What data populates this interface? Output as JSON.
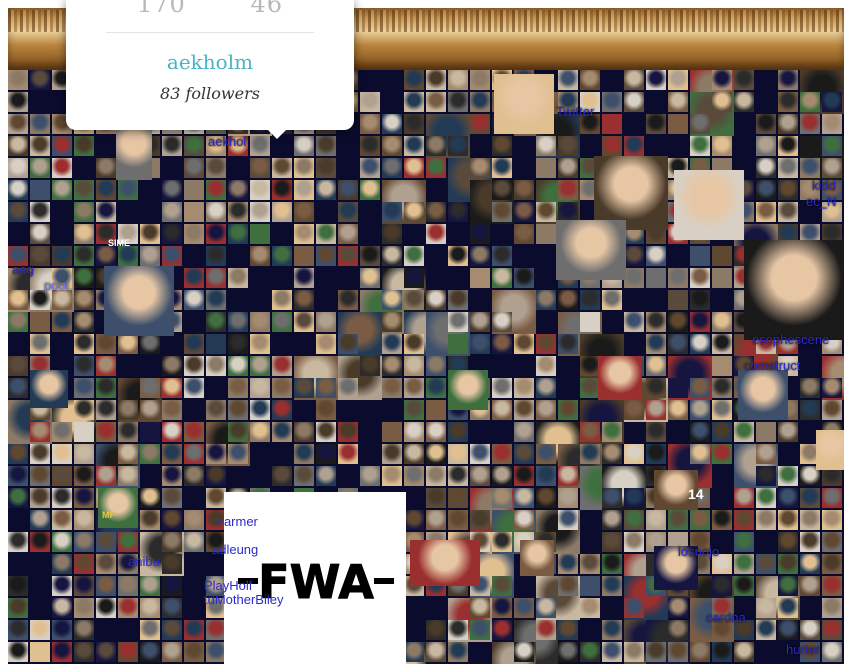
{
  "popup": {
    "stats": [
      "170",
      "46"
    ],
    "username": "aekholm",
    "followers": "83 followers"
  },
  "fwa_logo": "FWA",
  "handles": [
    {
      "text": "aekhol"
    },
    {
      "text": "Twitter"
    },
    {
      "text": "kidd"
    },
    {
      "text": "ec_N"
    },
    {
      "text": "aeg"
    },
    {
      "text": "pool"
    },
    {
      "text": "esophescene"
    },
    {
      "text": "comstruct"
    },
    {
      "text": "losnojo"
    },
    {
      "text": "cardna"
    },
    {
      "text": "hurter"
    },
    {
      "text": "Farmer"
    },
    {
      "text": "adleung"
    },
    {
      "text": "tdMotherBiley"
    },
    {
      "text": "PlayHolf"
    },
    {
      "text": "anibu"
    }
  ],
  "tile_labels": {
    "sime": "SIME",
    "mf": "MF",
    "fourteen": "14"
  },
  "colors": {
    "mosaic_bg": "#0b0b2e",
    "handle_blue": "#2a2ad0",
    "popup_name": "#4ab3c5"
  }
}
